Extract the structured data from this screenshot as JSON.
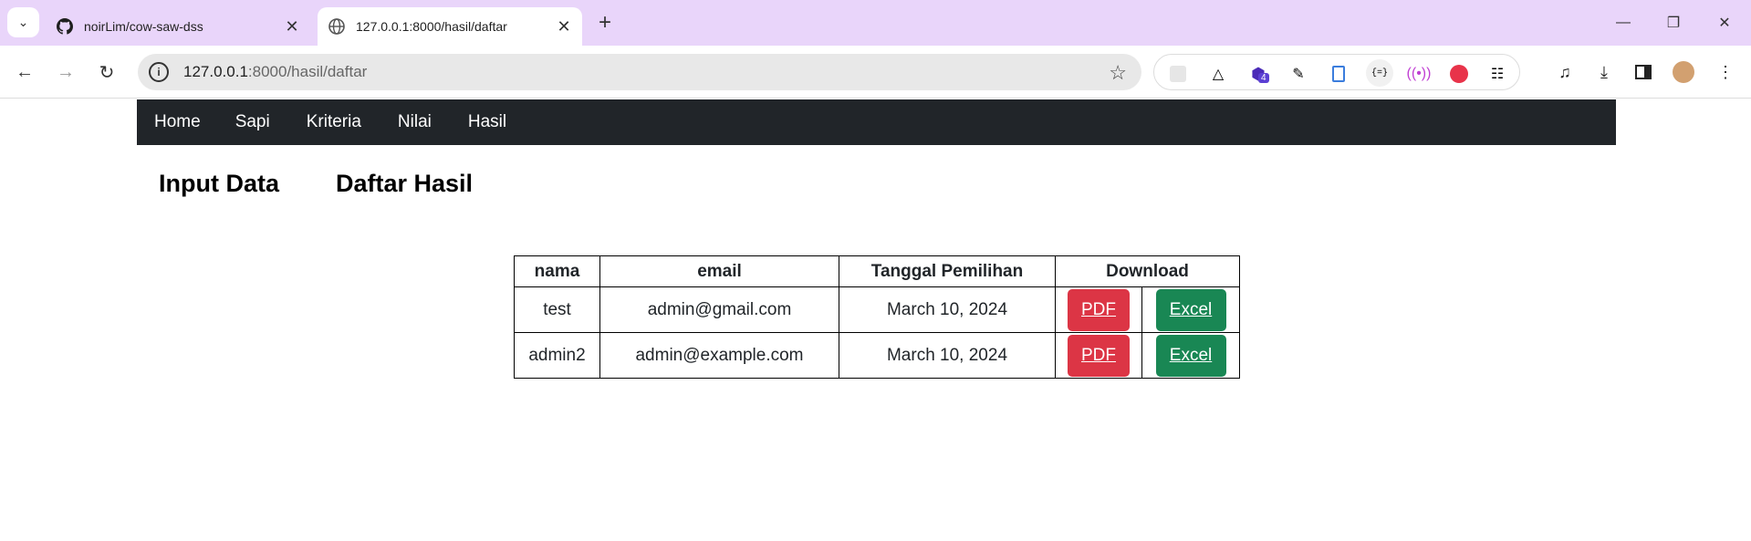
{
  "browser": {
    "tabs": [
      {
        "title": "noirLim/cow-saw-dss",
        "favicon": "github-icon",
        "active": false
      },
      {
        "title": "127.0.0.1:8000/hasil/daftar",
        "favicon": "globe-icon",
        "active": true
      }
    ],
    "url": {
      "host": "127.0.0.1",
      "path": ":8000/hasil/daftar"
    },
    "extension_badge": "4"
  },
  "navbar": {
    "items": [
      "Home",
      "Sapi",
      "Kriteria",
      "Nilai",
      "Hasil"
    ]
  },
  "sections": {
    "input_data": "Input Data",
    "daftar_hasil": "Daftar Hasil"
  },
  "table": {
    "headers": [
      "nama",
      "email",
      "Tanggal Pemilihan",
      "Download"
    ],
    "rows": [
      {
        "nama": "test",
        "email": "admin@gmail.com",
        "tanggal": "March 10, 2024",
        "pdf": "PDF",
        "excel": "Excel"
      },
      {
        "nama": "admin2",
        "email": "admin@example.com",
        "tanggal": "March 10, 2024",
        "pdf": "PDF",
        "excel": "Excel"
      }
    ]
  },
  "colors": {
    "navbar_bg": "#212529",
    "pdf_button": "#dc3545",
    "excel_button": "#198754",
    "tabstrip_bg": "#e9d5fa"
  }
}
